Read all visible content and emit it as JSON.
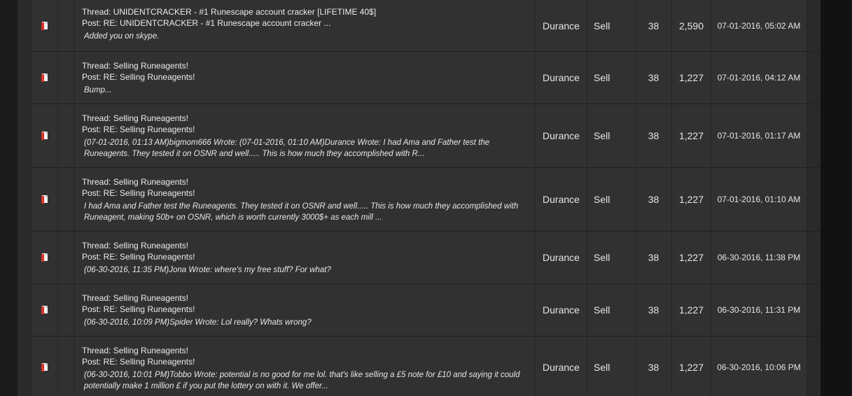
{
  "posts": [
    {
      "thread": "Thread: UNIDENTCRACKER - #1 Runescape account cracker [LIFETIME 40$]",
      "post": "Post: RE: UNIDENTCRACKER - #1 Runescape account cracker ...",
      "excerpt": "Added you on skype.",
      "author": "Durance",
      "forum": "Sell",
      "replies": "38",
      "views": "2,590",
      "date": "07-01-2016, 05:02 AM"
    },
    {
      "thread": "Thread: Selling Runeagents!",
      "post": "Post: RE: Selling Runeagents!",
      "excerpt": "Bump...",
      "author": "Durance",
      "forum": "Sell",
      "replies": "38",
      "views": "1,227",
      "date": "07-01-2016, 04:12 AM"
    },
    {
      "thread": "Thread: Selling Runeagents!",
      "post": "Post: RE: Selling Runeagents!",
      "excerpt": "(07-01-2016, 01:13 AM)bigmom666 Wrote: (07-01-2016, 01:10 AM)Durance Wrote: I had Ama and Father test the Runeagents. They tested it on OSNR and well..... This is how much they accomplished with R...",
      "author": "Durance",
      "forum": "Sell",
      "replies": "38",
      "views": "1,227",
      "date": "07-01-2016, 01:17 AM"
    },
    {
      "thread": "Thread: Selling Runeagents!",
      "post": "Post: RE: Selling Runeagents!",
      "excerpt": "I had Ama and Father test the Runeagents. They tested it on OSNR and well..... This is how much they accomplished with Runeagent, making 50b+ on OSNR, which is worth currently 3000$+ as each mill ...",
      "author": "Durance",
      "forum": "Sell",
      "replies": "38",
      "views": "1,227",
      "date": "07-01-2016, 01:10 AM"
    },
    {
      "thread": "Thread: Selling Runeagents!",
      "post": "Post: RE: Selling Runeagents!",
      "excerpt": "(06-30-2016, 11:35 PM)Jona Wrote: where's my free stuff? For what?",
      "author": "Durance",
      "forum": "Sell",
      "replies": "38",
      "views": "1,227",
      "date": "06-30-2016, 11:38 PM"
    },
    {
      "thread": "Thread: Selling Runeagents!",
      "post": "Post: RE: Selling Runeagents!",
      "excerpt": "(06-30-2016, 10:09 PM)Spider Wrote: Lol really? Whats wrong?",
      "author": "Durance",
      "forum": "Sell",
      "replies": "38",
      "views": "1,227",
      "date": "06-30-2016, 11:31 PM"
    },
    {
      "thread": "Thread: Selling Runeagents!",
      "post": "Post: RE: Selling Runeagents!",
      "excerpt": "(06-30-2016, 10:01 PM)Tobbo Wrote: potential is no good for me lol. that's like selling a £5 note for £10 and saying it could potentially make 1 million £ if you put the lottery on with it. We offer...",
      "author": "Durance",
      "forum": "Sell",
      "replies": "38",
      "views": "1,227",
      "date": "06-30-2016, 10:06 PM"
    }
  ]
}
